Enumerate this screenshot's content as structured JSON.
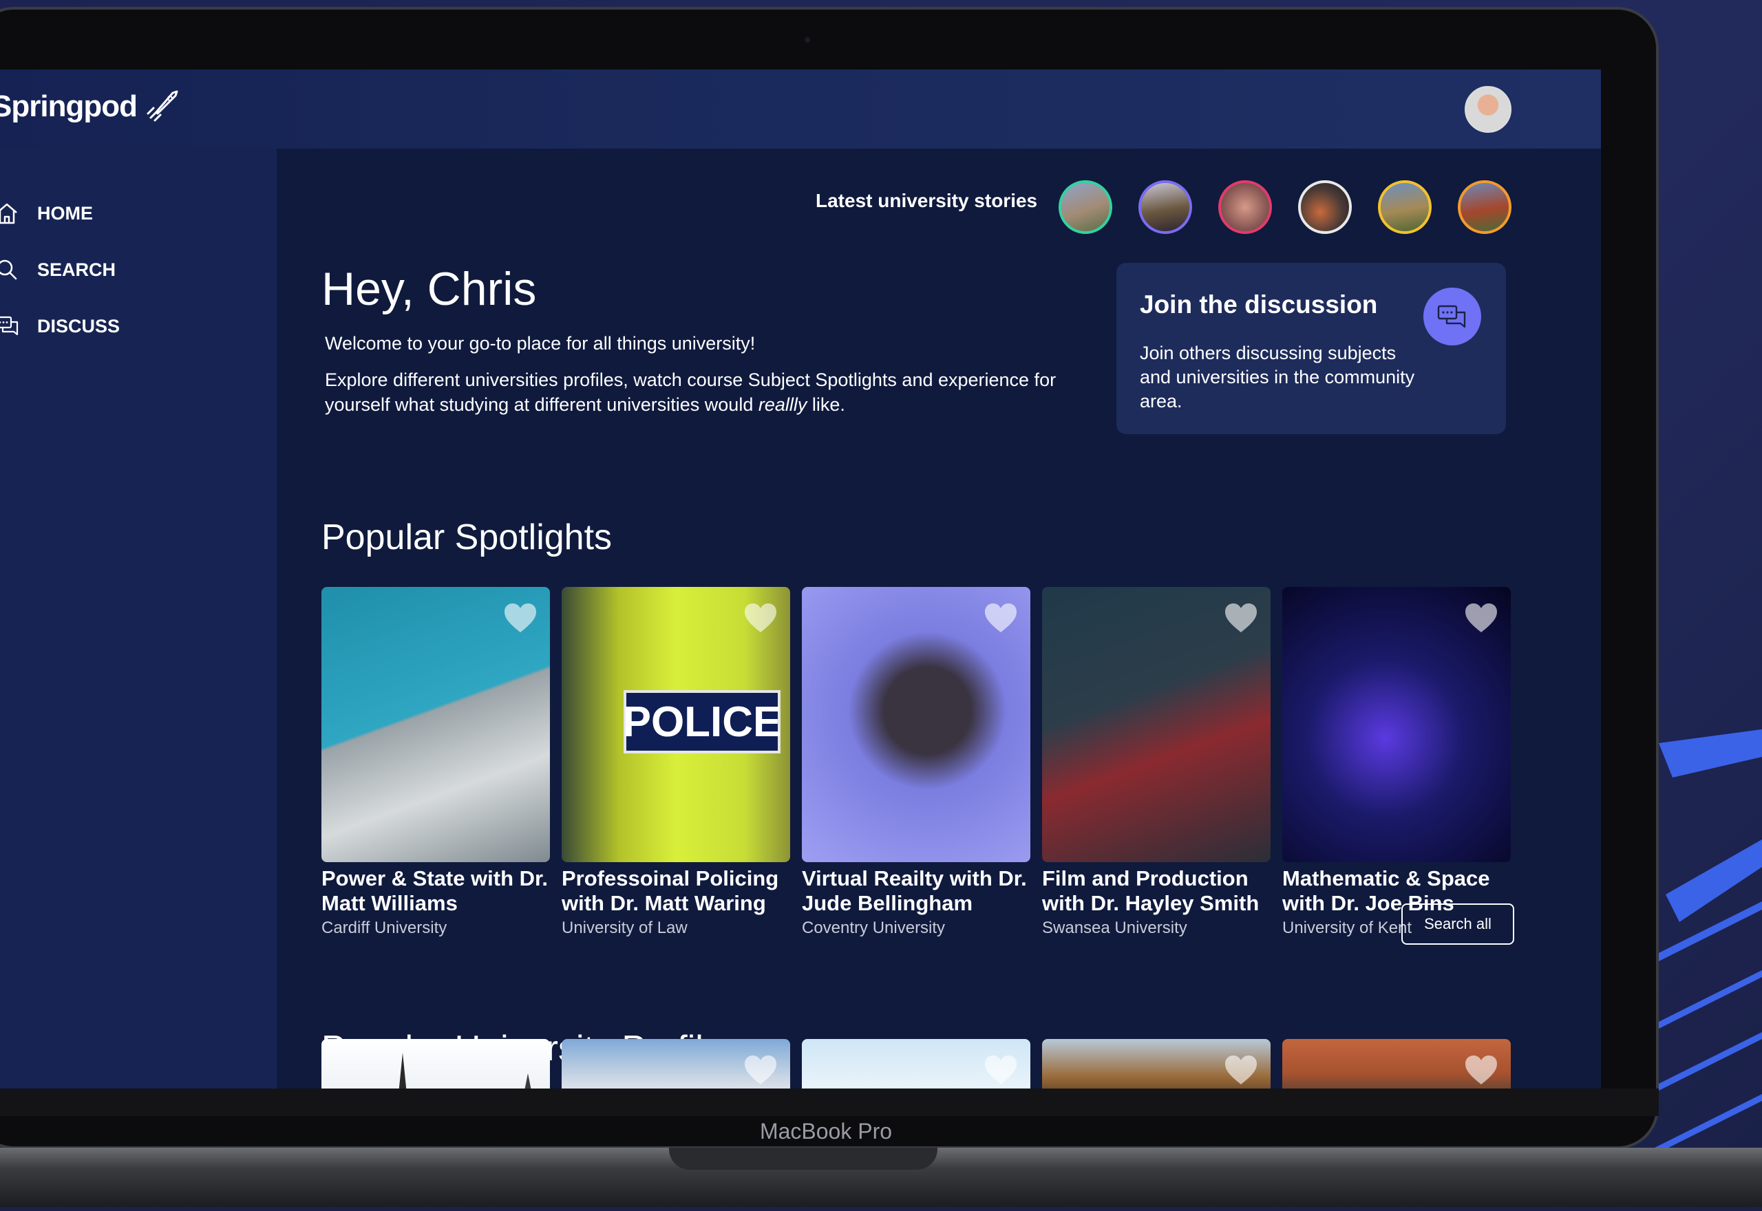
{
  "app": {
    "logo_text": "Springpod"
  },
  "sidebar": {
    "items": [
      {
        "label": "HOME",
        "icon": "home-icon"
      },
      {
        "label": "SEARCH",
        "icon": "search-icon"
      },
      {
        "label": "DISCUSS",
        "icon": "chat-icon"
      }
    ]
  },
  "stories": {
    "label": "Latest university stories",
    "rings": [
      "#35d19e",
      "#7a6cf0",
      "#e23b6a",
      "#e8e8e8",
      "#f2c12e",
      "#f29a2e"
    ]
  },
  "hero": {
    "greeting": "Hey, Chris",
    "welcome": "Welcome to your go-to place for all things university!",
    "explore": "Explore different universities profiles, watch course Subject Spotlights and experience for yourself what studying at different universities would",
    "explore_em": "reallly",
    "explore_end": " like."
  },
  "discussion": {
    "title": "Join the discussion",
    "desc": "Join others discussing subjects and universities in the community area.",
    "icon": "chat-bubbles-icon"
  },
  "spotlights": {
    "title": "Popular Spotlights",
    "cards": [
      {
        "title": "Power & State with Dr. Matt Williams",
        "university": "Cardiff University"
      },
      {
        "title": "Professoinal Policing with Dr. Matt Waring",
        "university": "University of Law"
      },
      {
        "title": "Virtual Reailty with Dr. Jude Bellingham",
        "university": "Coventry University"
      },
      {
        "title": "Film and Production with Dr. Hayley Smith",
        "university": "Swansea University"
      },
      {
        "title": "Mathematic & Space with Dr. Joe Bins",
        "university": "University of Kent"
      }
    ],
    "search_all": "Search all"
  },
  "profiles": {
    "title": "Popular University Profiles"
  },
  "device": {
    "label": "MacBook Pro"
  },
  "colors": {
    "accent": "#7072f5",
    "panel": "#1e2c5c",
    "background": "#0f1a3d"
  }
}
